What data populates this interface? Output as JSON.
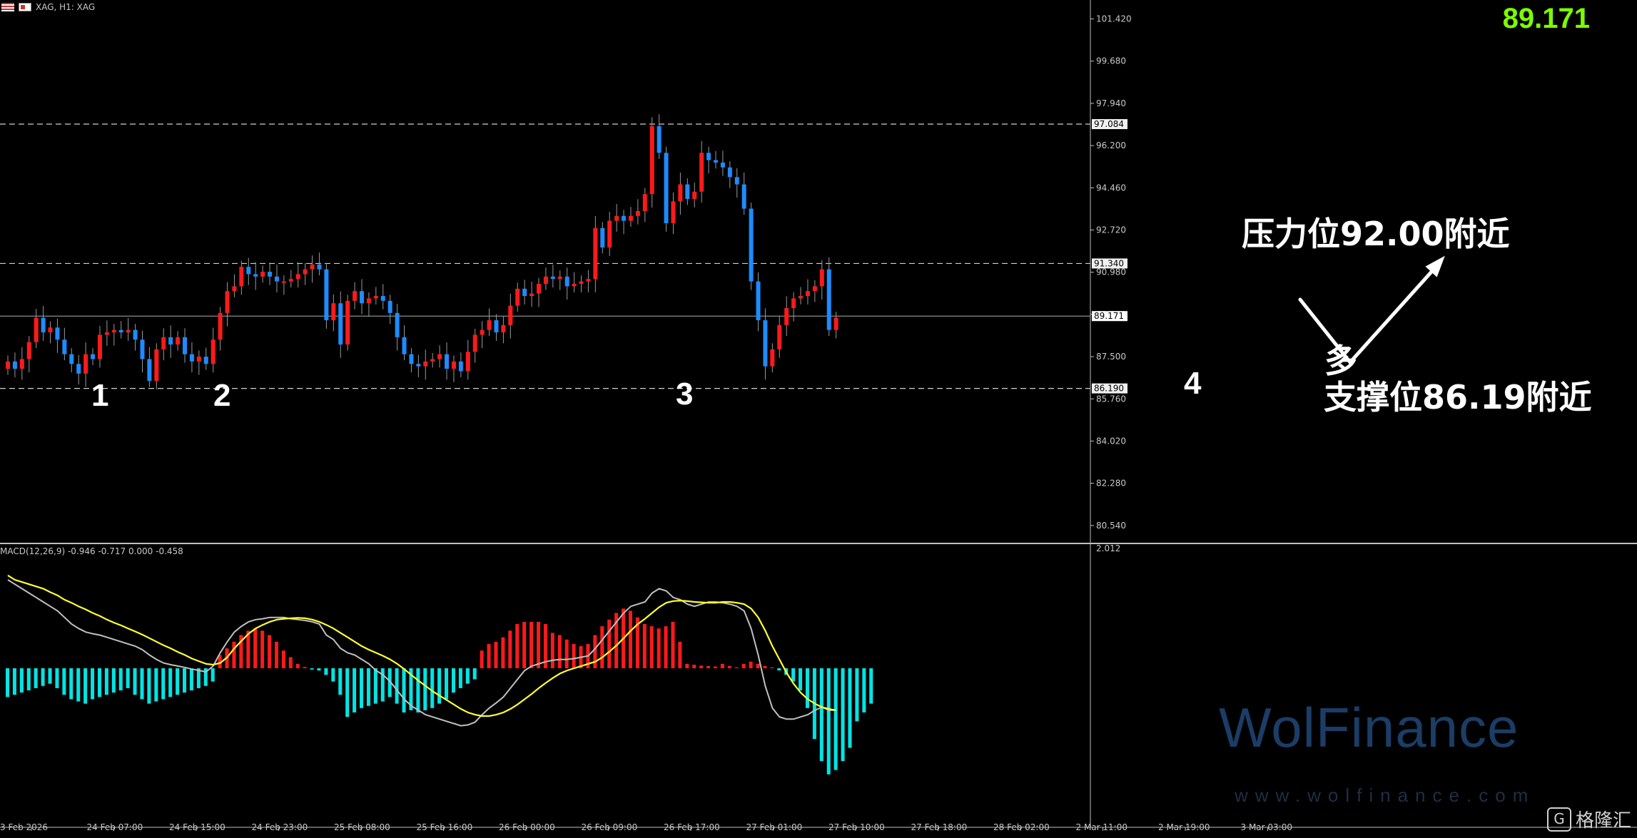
{
  "header": {
    "symbol_text": "XAG, H1: XAG"
  },
  "last_price": "89.171",
  "price_axis": {
    "ticks": [
      "101.420",
      "99.680",
      "97.940",
      "96.200",
      "94.460",
      "92.720",
      "90.980",
      "89.240",
      "87.500",
      "85.760",
      "84.020",
      "82.280",
      "80.540"
    ],
    "markers": [
      {
        "value": "97.084",
        "level": 97.084
      },
      {
        "value": "91.340",
        "level": 91.34
      },
      {
        "value": "89.171",
        "level": 89.171
      },
      {
        "value": "86.190",
        "level": 86.19
      }
    ]
  },
  "time_axis": [
    "3 Feb 2026",
    "24 Feb 07:00",
    "24 Feb 15:00",
    "24 Feb 23:00",
    "25 Feb 08:00",
    "25 Feb 16:00",
    "26 Feb 00:00",
    "26 Feb 09:00",
    "26 Feb 17:00",
    "27 Feb 01:00",
    "27 Feb 10:00",
    "27 Feb 18:00",
    "28 Feb 02:00",
    "2 Mar 11:00",
    "2 Mar 19:00",
    "3 Mar 03:00"
  ],
  "wave_labels": [
    "1",
    "2",
    "3",
    "4"
  ],
  "annotations": {
    "resistance": "压力位92.00附近",
    "support": "支撑位86.19附近",
    "bias": "多"
  },
  "macd": {
    "label": "MACD(12,26,9) -0.946 -0.717 0.000 -0.458",
    "axis_top": "2.012"
  },
  "watermark": {
    "brand": "WolFinance",
    "url": "www.wolfinance.com"
  },
  "corner_logo": "格隆汇",
  "colors": {
    "up": "#ff1a1a",
    "down": "#1e8bff",
    "hist_pos": "#ff1a1a",
    "hist_neg": "#00e5e5",
    "signal": "#ffff33",
    "macd_line": "#c0c0c0",
    "price": "#7cfc00"
  },
  "chart_data": {
    "type": "candlestick",
    "ylim": [
      79.8,
      102.2
    ],
    "closes": [
      87.3,
      87.0,
      87.4,
      88.1,
      89.1,
      88.5,
      88.7,
      88.2,
      87.6,
      87.2,
      86.8,
      87.6,
      87.4,
      88.4,
      88.5,
      88.6,
      88.5,
      88.6,
      88.2,
      87.4,
      86.5,
      87.8,
      88.3,
      88.0,
      88.3,
      87.6,
      87.3,
      87.5,
      87.2,
      88.2,
      89.3,
      90.2,
      90.4,
      91.2,
      90.9,
      90.8,
      91.0,
      90.8,
      90.6,
      90.6,
      90.7,
      90.9,
      91.1,
      91.3,
      91.1,
      89.0,
      89.7,
      88.0,
      89.8,
      90.2,
      89.7,
      89.9,
      90.0,
      89.8,
      89.3,
      88.3,
      87.6,
      87.2,
      87.1,
      87.3,
      87.4,
      87.6,
      87.0,
      87.3,
      86.9,
      87.7,
      88.4,
      88.6,
      89.0,
      88.5,
      88.8,
      89.6,
      90.3,
      90.0,
      90.1,
      90.5,
      90.8,
      90.7,
      90.8,
      90.4,
      90.5,
      90.6,
      90.7,
      92.8,
      92.0,
      93.1,
      93.3,
      93.1,
      93.3,
      93.5,
      94.2,
      97.0,
      95.9,
      93.0,
      93.9,
      94.6,
      94.0,
      94.3,
      95.9,
      95.6,
      95.5,
      95.3,
      94.9,
      94.6,
      93.6,
      90.6,
      89.0,
      87.1,
      87.8,
      88.8,
      89.5,
      89.9,
      90.0,
      90.2,
      90.4,
      91.1,
      88.6,
      89.1
    ],
    "macd_histogram": [
      -0.65,
      -0.6,
      -0.55,
      -0.5,
      -0.45,
      -0.4,
      -0.35,
      -0.45,
      -0.6,
      -0.7,
      -0.75,
      -0.8,
      -0.7,
      -0.65,
      -0.6,
      -0.55,
      -0.5,
      -0.45,
      -0.6,
      -0.7,
      -0.8,
      -0.75,
      -0.7,
      -0.65,
      -0.6,
      -0.55,
      -0.5,
      -0.45,
      -0.4,
      -0.3,
      0.3,
      0.45,
      0.6,
      0.75,
      0.85,
      0.9,
      0.85,
      0.75,
      0.6,
      0.4,
      0.25,
      0.1,
      0.03,
      -0.03,
      -0.05,
      -0.15,
      -0.3,
      -0.6,
      -1.1,
      -1.0,
      -0.9,
      -0.85,
      -0.8,
      -0.75,
      -0.65,
      -0.8,
      -1.0,
      -0.95,
      -1.0,
      -0.95,
      -0.9,
      -0.8,
      -0.7,
      -0.55,
      -0.45,
      -0.35,
      -0.25,
      0.4,
      0.55,
      0.6,
      0.7,
      0.85,
      1.0,
      1.05,
      1.05,
      1.05,
      1.0,
      0.8,
      0.75,
      0.65,
      0.55,
      0.5,
      0.55,
      0.75,
      0.95,
      1.1,
      1.25,
      1.35,
      1.3,
      1.15,
      1.0,
      0.95,
      0.9,
      0.95,
      1.05,
      0.6,
      0.1,
      0.08,
      0.06,
      0.05,
      0.04,
      0.1,
      0.05,
      0.02,
      0.1,
      0.15,
      0.1,
      0.05,
      0.02,
      -0.05,
      -0.15,
      -0.3,
      -0.5,
      -0.9,
      -1.6,
      -2.1,
      -2.4,
      -2.3,
      -2.1,
      -1.8,
      -1.2,
      -1.0,
      -0.8
    ],
    "macd_line": [
      2.0,
      1.9,
      1.8,
      1.7,
      1.6,
      1.5,
      1.4,
      1.3,
      1.15,
      1.0,
      0.9,
      0.82,
      0.78,
      0.75,
      0.7,
      0.65,
      0.6,
      0.55,
      0.5,
      0.42,
      0.3,
      0.2,
      0.12,
      0.08,
      0.05,
      0.02,
      -0.02,
      -0.05,
      -0.08,
      0.05,
      0.35,
      0.6,
      0.82,
      0.95,
      1.05,
      1.1,
      1.12,
      1.15,
      1.15,
      1.15,
      1.12,
      1.1,
      1.08,
      1.05,
      1.0,
      0.75,
      0.65,
      0.45,
      0.35,
      0.3,
      0.2,
      0.1,
      -0.05,
      -0.15,
      -0.3,
      -0.5,
      -0.7,
      -0.85,
      -0.95,
      -1.05,
      -1.1,
      -1.15,
      -1.2,
      -1.25,
      -1.3,
      -1.28,
      -1.22,
      -1.05,
      -0.9,
      -0.78,
      -0.65,
      -0.45,
      -0.25,
      -0.05,
      0.05,
      0.1,
      0.15,
      0.18,
      0.2,
      0.2,
      0.22,
      0.25,
      0.28,
      0.45,
      0.65,
      0.85,
      1.05,
      1.25,
      1.4,
      1.45,
      1.5,
      1.7,
      1.8,
      1.75,
      1.6,
      1.55,
      1.45,
      1.4,
      1.45,
      1.5,
      1.5,
      1.48,
      1.45,
      1.4,
      1.3,
      0.9,
      0.3,
      -0.4,
      -0.9,
      -1.1,
      -1.15,
      -1.15,
      -1.1,
      -1.05,
      -0.95,
      -0.88,
      -0.95,
      -0.95
    ],
    "signal_line": [
      2.1,
      2.0,
      1.95,
      1.9,
      1.85,
      1.8,
      1.72,
      1.65,
      1.55,
      1.48,
      1.4,
      1.33,
      1.25,
      1.18,
      1.1,
      1.03,
      0.97,
      0.9,
      0.83,
      0.76,
      0.68,
      0.6,
      0.52,
      0.45,
      0.37,
      0.3,
      0.22,
      0.16,
      0.1,
      0.08,
      0.12,
      0.25,
      0.45,
      0.62,
      0.78,
      0.9,
      0.98,
      1.05,
      1.1,
      1.12,
      1.13,
      1.14,
      1.13,
      1.1,
      1.05,
      0.98,
      0.9,
      0.8,
      0.7,
      0.6,
      0.5,
      0.42,
      0.35,
      0.28,
      0.2,
      0.1,
      -0.02,
      -0.15,
      -0.28,
      -0.4,
      -0.52,
      -0.62,
      -0.72,
      -0.82,
      -0.92,
      -1.0,
      -1.05,
      -1.08,
      -1.08,
      -1.05,
      -1.0,
      -0.92,
      -0.82,
      -0.7,
      -0.58,
      -0.45,
      -0.33,
      -0.22,
      -0.12,
      -0.05,
      0.0,
      0.05,
      0.1,
      0.15,
      0.25,
      0.38,
      0.52,
      0.68,
      0.85,
      1.0,
      1.12,
      1.25,
      1.38,
      1.48,
      1.52,
      1.53,
      1.52,
      1.5,
      1.49,
      1.48,
      1.48,
      1.5,
      1.5,
      1.48,
      1.45,
      1.35,
      1.15,
      0.85,
      0.5,
      0.2,
      -0.1,
      -0.35,
      -0.55,
      -0.7,
      -0.8,
      -0.88,
      -0.92,
      -0.95
    ]
  }
}
